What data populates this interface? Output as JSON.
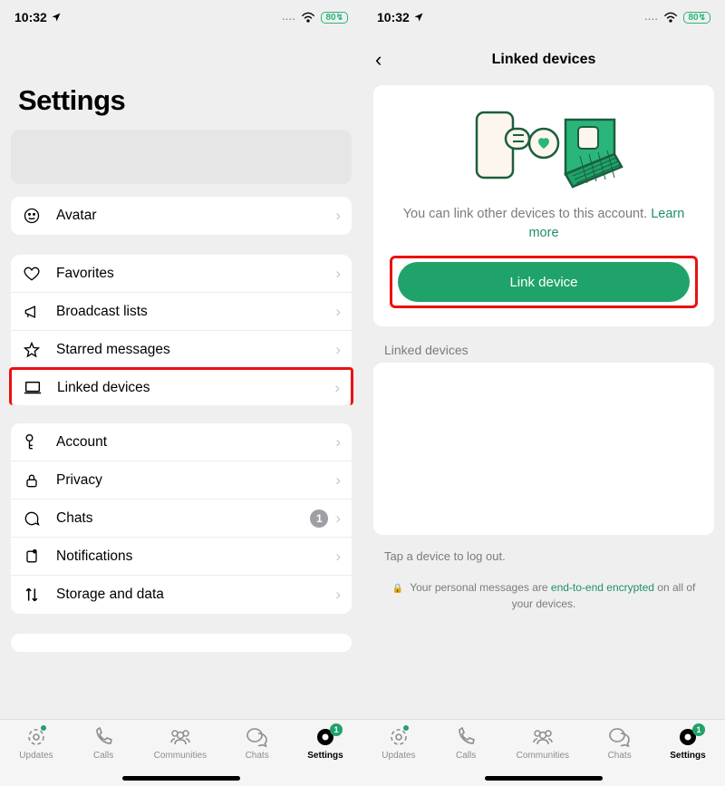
{
  "status": {
    "time": "10:32",
    "battery": "80",
    "dots": "...."
  },
  "screen1": {
    "title": "Settings",
    "groups": {
      "avatar": {
        "label": "Avatar"
      },
      "g1": [
        {
          "icon": "heart",
          "label": "Favorites"
        },
        {
          "icon": "megaphone",
          "label": "Broadcast lists"
        },
        {
          "icon": "star",
          "label": "Starred messages"
        },
        {
          "icon": "laptop",
          "label": "Linked devices",
          "highlighted": true
        }
      ],
      "g2": [
        {
          "icon": "key",
          "label": "Account"
        },
        {
          "icon": "lock",
          "label": "Privacy"
        },
        {
          "icon": "chat",
          "label": "Chats",
          "badge": "1"
        },
        {
          "icon": "bell",
          "label": "Notifications"
        },
        {
          "icon": "updown",
          "label": "Storage and data"
        }
      ]
    }
  },
  "screen2": {
    "title": "Linked devices",
    "hero_text": "You can link other devices to this account. ",
    "learn_more": "Learn more",
    "link_button": "Link device",
    "section_heading": "Linked devices",
    "hint": "Tap a device to log out.",
    "encrypt_prefix": "Your personal messages are ",
    "encrypt_link": "end-to-end encrypted",
    "encrypt_suffix": " on all of your devices."
  },
  "tabs": [
    {
      "id": "updates",
      "label": "Updates",
      "dot": true
    },
    {
      "id": "calls",
      "label": "Calls"
    },
    {
      "id": "communities",
      "label": "Communities"
    },
    {
      "id": "chats",
      "label": "Chats"
    },
    {
      "id": "settings",
      "label": "Settings",
      "active": true,
      "badge": "1"
    }
  ]
}
